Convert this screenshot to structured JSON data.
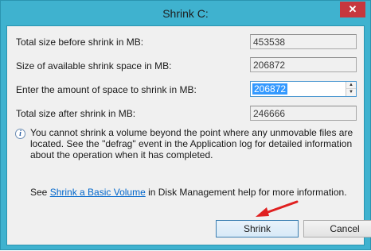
{
  "window": {
    "title": "Shrink C:",
    "close_glyph": "✕"
  },
  "fields": {
    "total_before_label": "Total size before shrink in MB:",
    "total_before_value": "453538",
    "available_label": "Size of available shrink space in MB:",
    "available_value": "206872",
    "amount_label": "Enter the amount of space to shrink in MB:",
    "amount_value": "206872",
    "total_after_label": "Total size after shrink in MB:",
    "total_after_value": "246666"
  },
  "info": {
    "icon_glyph": "i",
    "text": "You cannot shrink a volume beyond the point where any unmovable files are located. See the \"defrag\" event in the Application log for detailed information about the operation when it has completed."
  },
  "help": {
    "prefix": "See ",
    "link": "Shrink a Basic Volume",
    "suffix": " in Disk Management help for more information."
  },
  "buttons": {
    "shrink": "Shrink",
    "cancel": "Cancel"
  },
  "colors": {
    "title_bar": "#3fb2cf",
    "close_button": "#c7373e",
    "annotation_arrow": "#e02020",
    "selection": "#3399ff"
  }
}
